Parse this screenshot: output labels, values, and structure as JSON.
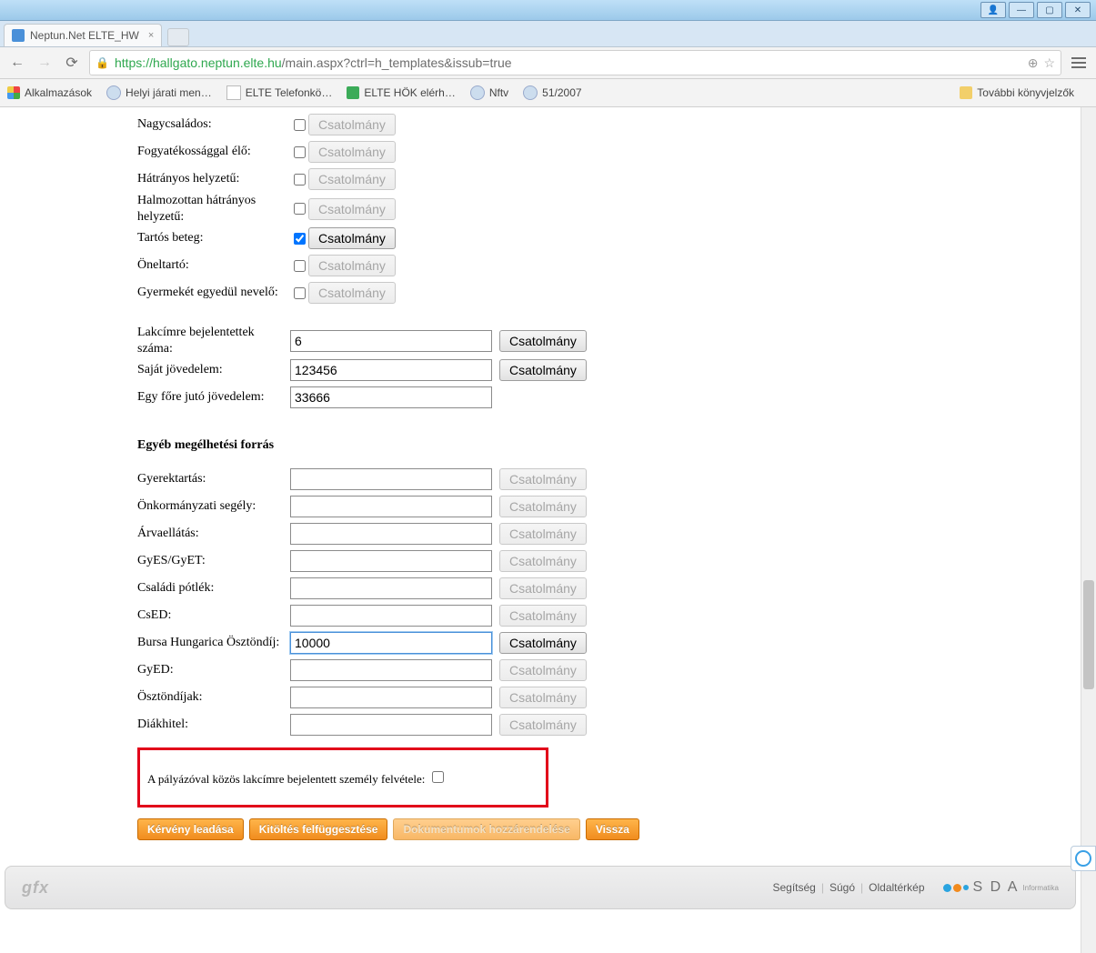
{
  "window": {
    "user_icon": "👤",
    "min": "—",
    "max": "▢",
    "close": "✕"
  },
  "tab": {
    "title": "Neptun.Net ELTE_HW",
    "close": "×"
  },
  "toolbar": {
    "back": "←",
    "forward": "→",
    "reload": "⟳",
    "url_scheme": "https://",
    "url_host": "hallgato.neptun.elte.hu",
    "url_path": "/main.aspx?ctrl=h_templates&issub=true",
    "zoom_icon": "⊕",
    "star": "☆"
  },
  "bookmarks": {
    "apps": "Alkalmazások",
    "b1": "Helyi járati men…",
    "b2": "ELTE Telefonkö…",
    "b3": "ELTE HÖK elérh…",
    "b4": "Nftv",
    "b5": "51/2007",
    "more": "További könyvjelzők"
  },
  "form": {
    "checks": [
      {
        "label": "Nagycsaládos:",
        "checked": false,
        "enabled": false
      },
      {
        "label": "Fogyatékossággal élő:",
        "checked": false,
        "enabled": false
      },
      {
        "label": "Hátrányos helyzetű:",
        "checked": false,
        "enabled": false
      },
      {
        "label": "Halmozottan hátrányos helyzetű:",
        "checked": false,
        "enabled": false
      },
      {
        "label": "Tartós beteg:",
        "checked": true,
        "enabled": true
      },
      {
        "label": "Öneltartó:",
        "checked": false,
        "enabled": false
      },
      {
        "label": "Gyermekét egyedül nevelő:",
        "checked": false,
        "enabled": false
      }
    ],
    "numbers": [
      {
        "label": "Lakcímre bejelentettek száma:",
        "value": "6",
        "attach_enabled": true
      },
      {
        "label": "Saját jövedelem:",
        "value": "123456",
        "attach_enabled": true
      },
      {
        "label": "Egy főre jutó jövedelem:",
        "value": "33666",
        "attach_enabled": null
      }
    ],
    "section2_title": "Egyéb megélhetési forrás",
    "others": [
      {
        "label": "Gyerektartás:",
        "value": "",
        "attach_enabled": false
      },
      {
        "label": "Önkormányzati segély:",
        "value": "",
        "attach_enabled": false
      },
      {
        "label": "Árvaellátás:",
        "value": "",
        "attach_enabled": false
      },
      {
        "label": "GyES/GyET:",
        "value": "",
        "attach_enabled": false
      },
      {
        "label": "Családi pótlék:",
        "value": "",
        "attach_enabled": false
      },
      {
        "label": "CsED:",
        "value": "",
        "attach_enabled": false
      },
      {
        "label": "Bursa Hungarica Ösztöndíj:",
        "value": "10000",
        "attach_enabled": true,
        "focused": true
      },
      {
        "label": "GyED:",
        "value": "",
        "attach_enabled": false
      },
      {
        "label": "Ösztöndíjak:",
        "value": "",
        "attach_enabled": false
      },
      {
        "label": "Diákhitel:",
        "value": "",
        "attach_enabled": false
      }
    ],
    "attach_label": "Csatolmány",
    "highlight_label": "A pályázóval közös lakcímre bejelentett személy felvétele:"
  },
  "actions": {
    "submit": "Kérvény leadása",
    "suspend": "Kitöltés felfüggesztése",
    "docs": "Dokumentumok hozzárendelése",
    "back": "Vissza"
  },
  "footer": {
    "gfx": "gfx",
    "help": "Segítség",
    "sugo": "Súgó",
    "sitemap": "Oldaltérkép",
    "logo_text": "S D A",
    "logo_sub": "Informatika"
  }
}
